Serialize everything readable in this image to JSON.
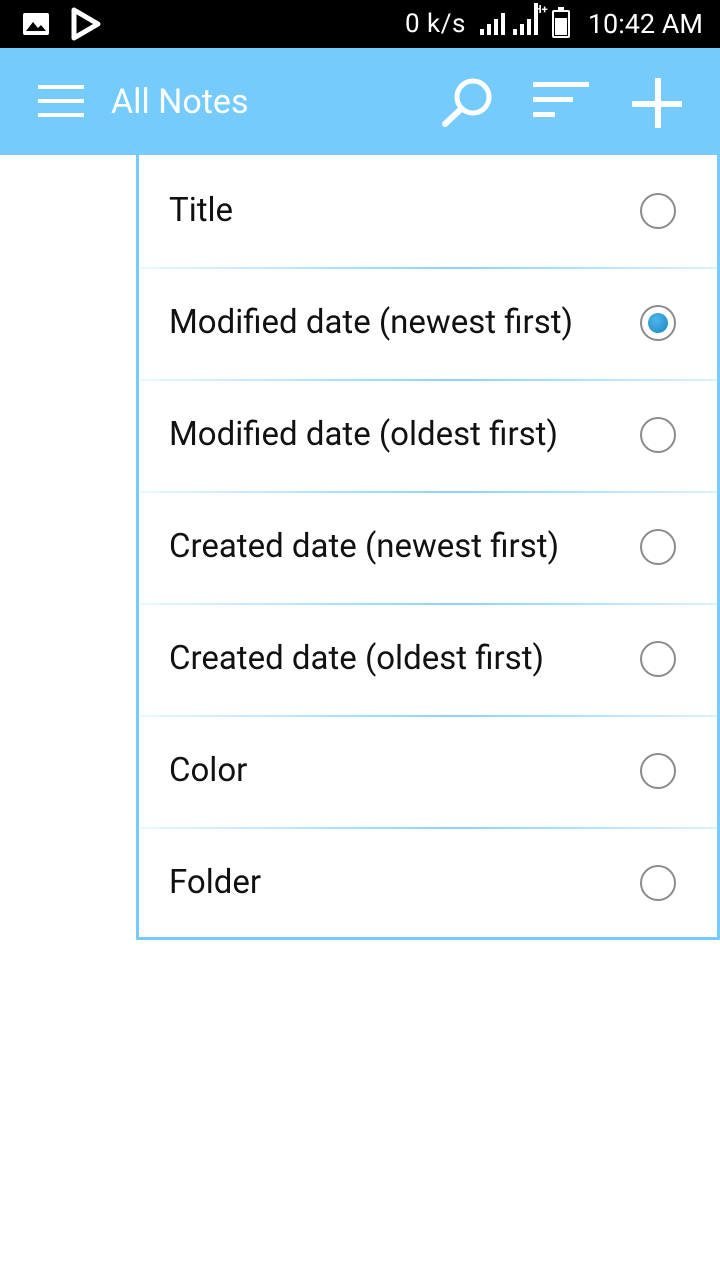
{
  "status_bar": {
    "net_speed": "0 k/s",
    "signal_label": "H+",
    "time": "10:42 AM"
  },
  "app_bar": {
    "title": "All Notes"
  },
  "sort_menu": {
    "options": [
      {
        "label": "Title",
        "selected": false
      },
      {
        "label": "Modified date (newest first)",
        "selected": true
      },
      {
        "label": "Modified date (oldest first)",
        "selected": false
      },
      {
        "label": "Created date (newest first)",
        "selected": false
      },
      {
        "label": "Created date (oldest first)",
        "selected": false
      },
      {
        "label": "Color",
        "selected": false
      },
      {
        "label": "Folder",
        "selected": false
      }
    ]
  },
  "colors": {
    "accent": "#74cbfc",
    "radio_selected": "#1a86c6"
  }
}
